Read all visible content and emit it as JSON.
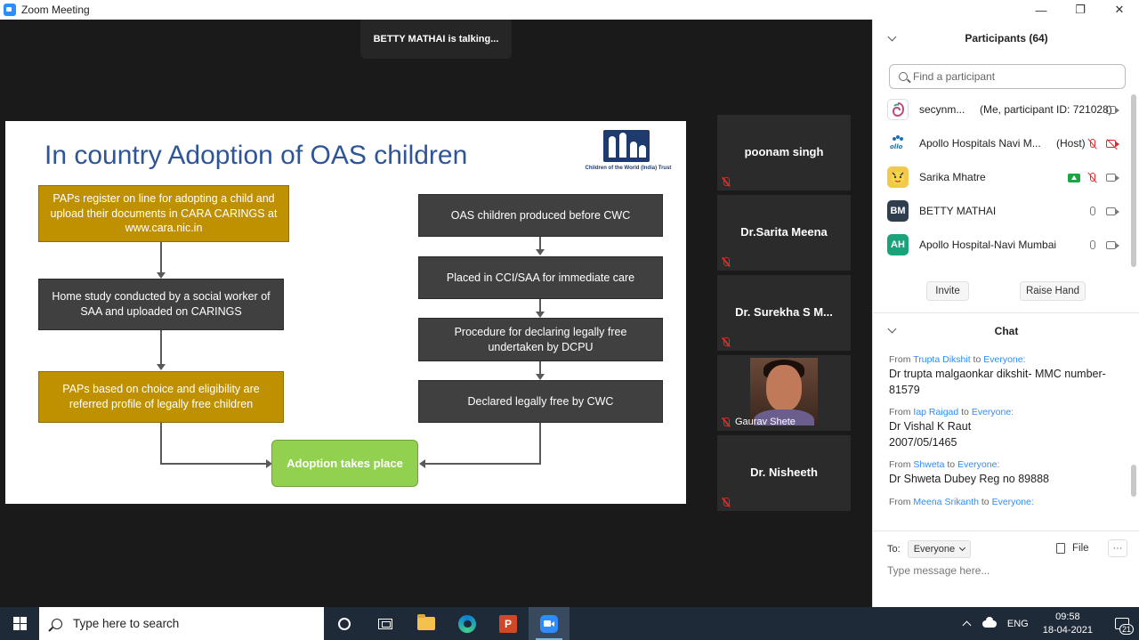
{
  "window": {
    "title": "Zoom Meeting",
    "minimize": "—",
    "restore": "❐",
    "close": "✕"
  },
  "talking_indicator": "BETTY MATHAI is talking...",
  "slide": {
    "title": "In country Adoption of OAS children",
    "logo_caption": "Children of the World (India) Trust",
    "left_flow": [
      "PAPs register on line for adopting a child and upload their documents in  CARA CARINGS  at www.cara.nic.in",
      "Home study conducted by a social worker of SAA and uploaded on CARINGS",
      "PAPs based on choice and eligibility are referred profile of legally free children"
    ],
    "right_flow": [
      "OAS children produced before CWC",
      "Placed in CCI/SAA for immediate care",
      "Procedure for declaring legally free undertaken by DCPU",
      "Declared legally free by CWC"
    ],
    "final_box": "Adoption  takes place",
    "colors": {
      "gold": "#bf9000",
      "dark": "#404040",
      "green": "#92d050",
      "title": "#2f5597"
    }
  },
  "video_tiles": [
    {
      "name": "poonam singh",
      "muted": true
    },
    {
      "name": "Dr.Sarita Meena",
      "muted": true
    },
    {
      "name": "Dr. Surekha S M...",
      "muted": true
    },
    {
      "name": "Gaurav Shete",
      "muted": true,
      "has_video": true
    },
    {
      "name": "Dr. Nisheeth",
      "muted": true
    }
  ],
  "participants": {
    "header": "Participants (64)",
    "search_placeholder": "Find a participant",
    "list": [
      {
        "name": "secynm...",
        "role": "(Me, participant ID: 721028)",
        "avatar": "",
        "avatar_color": "#ffffff"
      },
      {
        "name": "Apollo Hospitals Navi M...",
        "role": "(Host)",
        "avatar": "",
        "avatar_color": "#ffffff"
      },
      {
        "name": "Sarika Mhatre",
        "role": "",
        "avatar": "",
        "avatar_color": "#f2c94c"
      },
      {
        "name": "BETTY MATHAI",
        "role": "",
        "avatar": "BM",
        "avatar_color": "#2f3e4e"
      },
      {
        "name": "Apollo Hospital-Navi Mumbai",
        "role": "",
        "avatar": "AH",
        "avatar_color": "#1aa37a"
      }
    ],
    "invite_label": "Invite",
    "raise_hand_label": "Raise Hand"
  },
  "chat": {
    "header": "Chat",
    "from_word": "From",
    "to_word": "to",
    "messages": [
      {
        "from": "Trupta Dikshit",
        "to": "Everyone:",
        "text": "Dr trupta malgaonkar dikshit- MMC number- 81579"
      },
      {
        "from": "Iap Raigad",
        "to": "Everyone:",
        "text": "Dr Vishal K Raut 2007/05/1465"
      },
      {
        "from": "Shweta",
        "to": "Everyone:",
        "text": "Dr Shweta Dubey Reg no 89888"
      },
      {
        "from": "Meena Srikanth",
        "to": "Everyone:",
        "text": ""
      }
    ],
    "to_label": "To:",
    "recipient": "Everyone",
    "file_label": "File",
    "more_label": "···",
    "input_placeholder": "Type message here..."
  },
  "taskbar": {
    "search_placeholder": "Type here to search",
    "ppt_letter": "P",
    "lang": "ENG",
    "time": "09:58",
    "date": "18-04-2021",
    "notif_count": "21"
  }
}
